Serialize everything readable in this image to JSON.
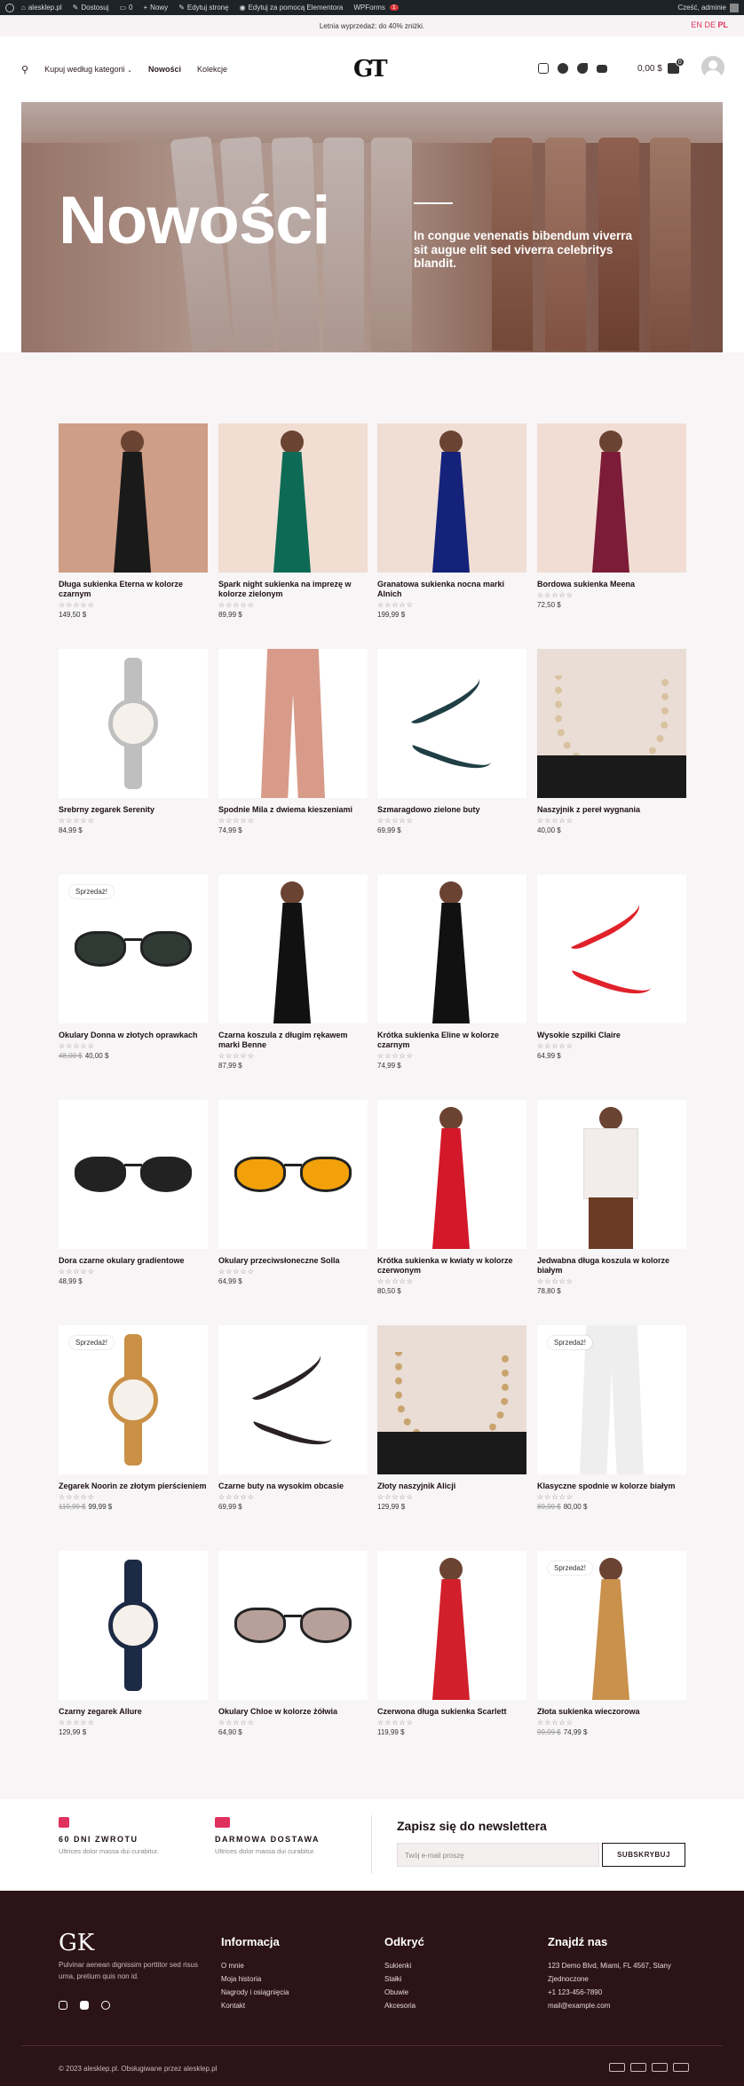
{
  "adminbar": {
    "items": [
      {
        "label": "alesklep.pl"
      },
      {
        "label": "Dostosuj"
      },
      {
        "label": "0"
      },
      {
        "label": "Nowy"
      },
      {
        "label": "Edytuj stronę"
      },
      {
        "label": "Edytuj za pomocą Elementora"
      },
      {
        "label": "WPForms"
      }
    ],
    "wpforms_badge": "1",
    "greeting": "Cześć, adminie"
  },
  "topbar": {
    "promo": "Letnia wyprzedaż: do 40% zniżki.",
    "langs": [
      "EN",
      "DE",
      "PL"
    ]
  },
  "header": {
    "nav": [
      "Kupuj według kategorii",
      "Nowości",
      "Kolekcje"
    ],
    "logo": "GT",
    "cart_total": "0,00 $",
    "cart_count": "0"
  },
  "hero": {
    "title": "Nowości",
    "text": "In congue venenatis bibendum viverra sit augue elit sed viverra celebritys blandit."
  },
  "products": [
    {
      "name": "Długa sukienka Eterna w kolorze czarnym",
      "price": "149,50 $",
      "old_price": "",
      "sale": false
    },
    {
      "name": "Spark night sukienka na imprezę w kolorze zielonym",
      "price": "89,99 $",
      "old_price": "",
      "sale": false
    },
    {
      "name": "Granatowa sukienka nocna marki Alnich",
      "price": "199,99 $",
      "old_price": "",
      "sale": false
    },
    {
      "name": "Bordowa sukienka Meena",
      "price": "72,50 $",
      "old_price": "",
      "sale": false
    },
    {
      "name": "Srebrny zegarek Serenity",
      "price": "84,99 $",
      "old_price": "",
      "sale": false
    },
    {
      "name": "Spodnie Mila z dwiema kieszeniami",
      "price": "74,99 $",
      "old_price": "",
      "sale": false
    },
    {
      "name": "Szmaragdowo zielone buty",
      "price": "69,99 $",
      "old_price": "",
      "sale": false
    },
    {
      "name": "Naszyjnik z pereł wygnania",
      "price": "40,00 $",
      "old_price": "",
      "sale": false
    },
    {
      "name": "Okulary Donna w złotych oprawkach",
      "price": "40,00 $",
      "old_price": "48,00 $",
      "sale": true
    },
    {
      "name": "Czarna koszula z długim rękawem marki Benne",
      "price": "87,99 $",
      "old_price": "",
      "sale": false
    },
    {
      "name": "Krótka sukienka Eline w kolorze czarnym",
      "price": "74,99 $",
      "old_price": "",
      "sale": false
    },
    {
      "name": "Wysokie szpilki Claire",
      "price": "64,99 $",
      "old_price": "",
      "sale": false
    },
    {
      "name": "Dora czarne okulary gradientowe",
      "price": "48,99 $",
      "old_price": "",
      "sale": false
    },
    {
      "name": "Okulary przeciwsłoneczne Solla",
      "price": "64,99 $",
      "old_price": "",
      "sale": false
    },
    {
      "name": "Krótka sukienka w kwiaty w kolorze czerwonym",
      "price": "80,50 $",
      "old_price": "",
      "sale": false
    },
    {
      "name": "Jedwabna długa koszula w kolorze białym",
      "price": "78,80 $",
      "old_price": "",
      "sale": false
    },
    {
      "name": "Zegarek Noorin ze złotym pierścieniem",
      "price": "99,99 $",
      "old_price": "119,99 $",
      "sale": true
    },
    {
      "name": "Czarne buty na wysokim obcasie",
      "price": "69,99 $",
      "old_price": "",
      "sale": false
    },
    {
      "name": "Złoty naszyjnik Alicji",
      "price": "129,99 $",
      "old_price": "",
      "sale": false
    },
    {
      "name": "Klasyczne spodnie w kolorze białym",
      "price": "80,00 $",
      "old_price": "89,99 $",
      "sale": true
    },
    {
      "name": "Czarny zegarek Allure",
      "price": "129,99 $",
      "old_price": "",
      "sale": false
    },
    {
      "name": "Okulary Chloe w kolorze żółwia",
      "price": "64,90 $",
      "old_price": "",
      "sale": false
    },
    {
      "name": "Czerwona długa sukienka Scarlett",
      "price": "119,99 $",
      "old_price": "",
      "sale": false
    },
    {
      "name": "Złota sukienka wieczorowa",
      "price": "74,99 $",
      "old_price": "99,99 $",
      "sale": true
    }
  ],
  "sale_label": "Sprzedaż!",
  "stars": "☆☆☆☆☆",
  "newsletter": {
    "feature1_title": "60 DNI ZWROTU",
    "feature1_text": "Ultrices dolor massa dui curabitur.",
    "feature2_title": "DARMOWA DOSTAWA",
    "feature2_text": "Ultrices dolor massa dui curabitur.",
    "title": "Zapisz się do newslettera",
    "placeholder": "Twój e-mail proszę",
    "button": "SUBSKRYBUJ"
  },
  "footer": {
    "logo": "GK",
    "desc": "Pulvinar aenean dignissim porttitor sed risus urna, pretium quis non id.",
    "col1_title": "Informacja",
    "col1": [
      "O mnie",
      "Moja historia",
      "Nagrody i osiągnięcia",
      "Kontakt"
    ],
    "col2_title": "Odkryć",
    "col2": [
      "Sukienki",
      "Stałki",
      "Obuwie",
      "Akcesoria"
    ],
    "col3_title": "Znajdź nas",
    "col3": [
      "123 Demo Blvd, Miami, FL 4567, Stany Zjednoczone",
      "+1 123-456-7890",
      "mail@example.com"
    ],
    "copyright": "© 2023 alesklep.pl. Obsługiwane przez alesklep.pl"
  },
  "colors": {
    "accent": "#e0315e",
    "footer_bg": "#2b1318",
    "adminbar": "#1d2327"
  }
}
